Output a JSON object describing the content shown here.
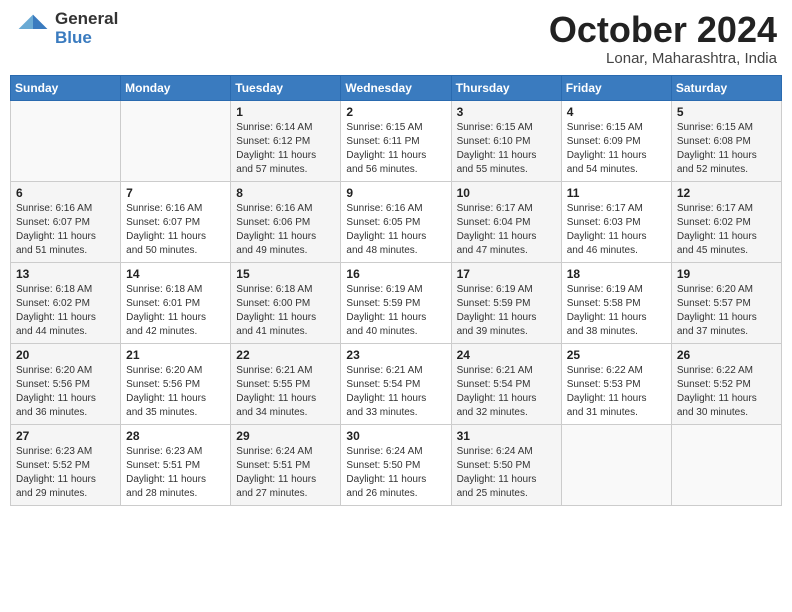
{
  "header": {
    "logo_general": "General",
    "logo_blue": "Blue",
    "month": "October 2024",
    "location": "Lonar, Maharashtra, India"
  },
  "weekdays": [
    "Sunday",
    "Monday",
    "Tuesday",
    "Wednesday",
    "Thursday",
    "Friday",
    "Saturday"
  ],
  "weeks": [
    [
      {
        "day": "",
        "info": ""
      },
      {
        "day": "",
        "info": ""
      },
      {
        "day": "1",
        "info": "Sunrise: 6:14 AM\nSunset: 6:12 PM\nDaylight: 11 hours and 57 minutes."
      },
      {
        "day": "2",
        "info": "Sunrise: 6:15 AM\nSunset: 6:11 PM\nDaylight: 11 hours and 56 minutes."
      },
      {
        "day": "3",
        "info": "Sunrise: 6:15 AM\nSunset: 6:10 PM\nDaylight: 11 hours and 55 minutes."
      },
      {
        "day": "4",
        "info": "Sunrise: 6:15 AM\nSunset: 6:09 PM\nDaylight: 11 hours and 54 minutes."
      },
      {
        "day": "5",
        "info": "Sunrise: 6:15 AM\nSunset: 6:08 PM\nDaylight: 11 hours and 52 minutes."
      }
    ],
    [
      {
        "day": "6",
        "info": "Sunrise: 6:16 AM\nSunset: 6:07 PM\nDaylight: 11 hours and 51 minutes."
      },
      {
        "day": "7",
        "info": "Sunrise: 6:16 AM\nSunset: 6:07 PM\nDaylight: 11 hours and 50 minutes."
      },
      {
        "day": "8",
        "info": "Sunrise: 6:16 AM\nSunset: 6:06 PM\nDaylight: 11 hours and 49 minutes."
      },
      {
        "day": "9",
        "info": "Sunrise: 6:16 AM\nSunset: 6:05 PM\nDaylight: 11 hours and 48 minutes."
      },
      {
        "day": "10",
        "info": "Sunrise: 6:17 AM\nSunset: 6:04 PM\nDaylight: 11 hours and 47 minutes."
      },
      {
        "day": "11",
        "info": "Sunrise: 6:17 AM\nSunset: 6:03 PM\nDaylight: 11 hours and 46 minutes."
      },
      {
        "day": "12",
        "info": "Sunrise: 6:17 AM\nSunset: 6:02 PM\nDaylight: 11 hours and 45 minutes."
      }
    ],
    [
      {
        "day": "13",
        "info": "Sunrise: 6:18 AM\nSunset: 6:02 PM\nDaylight: 11 hours and 44 minutes."
      },
      {
        "day": "14",
        "info": "Sunrise: 6:18 AM\nSunset: 6:01 PM\nDaylight: 11 hours and 42 minutes."
      },
      {
        "day": "15",
        "info": "Sunrise: 6:18 AM\nSunset: 6:00 PM\nDaylight: 11 hours and 41 minutes."
      },
      {
        "day": "16",
        "info": "Sunrise: 6:19 AM\nSunset: 5:59 PM\nDaylight: 11 hours and 40 minutes."
      },
      {
        "day": "17",
        "info": "Sunrise: 6:19 AM\nSunset: 5:59 PM\nDaylight: 11 hours and 39 minutes."
      },
      {
        "day": "18",
        "info": "Sunrise: 6:19 AM\nSunset: 5:58 PM\nDaylight: 11 hours and 38 minutes."
      },
      {
        "day": "19",
        "info": "Sunrise: 6:20 AM\nSunset: 5:57 PM\nDaylight: 11 hours and 37 minutes."
      }
    ],
    [
      {
        "day": "20",
        "info": "Sunrise: 6:20 AM\nSunset: 5:56 PM\nDaylight: 11 hours and 36 minutes."
      },
      {
        "day": "21",
        "info": "Sunrise: 6:20 AM\nSunset: 5:56 PM\nDaylight: 11 hours and 35 minutes."
      },
      {
        "day": "22",
        "info": "Sunrise: 6:21 AM\nSunset: 5:55 PM\nDaylight: 11 hours and 34 minutes."
      },
      {
        "day": "23",
        "info": "Sunrise: 6:21 AM\nSunset: 5:54 PM\nDaylight: 11 hours and 33 minutes."
      },
      {
        "day": "24",
        "info": "Sunrise: 6:21 AM\nSunset: 5:54 PM\nDaylight: 11 hours and 32 minutes."
      },
      {
        "day": "25",
        "info": "Sunrise: 6:22 AM\nSunset: 5:53 PM\nDaylight: 11 hours and 31 minutes."
      },
      {
        "day": "26",
        "info": "Sunrise: 6:22 AM\nSunset: 5:52 PM\nDaylight: 11 hours and 30 minutes."
      }
    ],
    [
      {
        "day": "27",
        "info": "Sunrise: 6:23 AM\nSunset: 5:52 PM\nDaylight: 11 hours and 29 minutes."
      },
      {
        "day": "28",
        "info": "Sunrise: 6:23 AM\nSunset: 5:51 PM\nDaylight: 11 hours and 28 minutes."
      },
      {
        "day": "29",
        "info": "Sunrise: 6:24 AM\nSunset: 5:51 PM\nDaylight: 11 hours and 27 minutes."
      },
      {
        "day": "30",
        "info": "Sunrise: 6:24 AM\nSunset: 5:50 PM\nDaylight: 11 hours and 26 minutes."
      },
      {
        "day": "31",
        "info": "Sunrise: 6:24 AM\nSunset: 5:50 PM\nDaylight: 11 hours and 25 minutes."
      },
      {
        "day": "",
        "info": ""
      },
      {
        "day": "",
        "info": ""
      }
    ]
  ]
}
